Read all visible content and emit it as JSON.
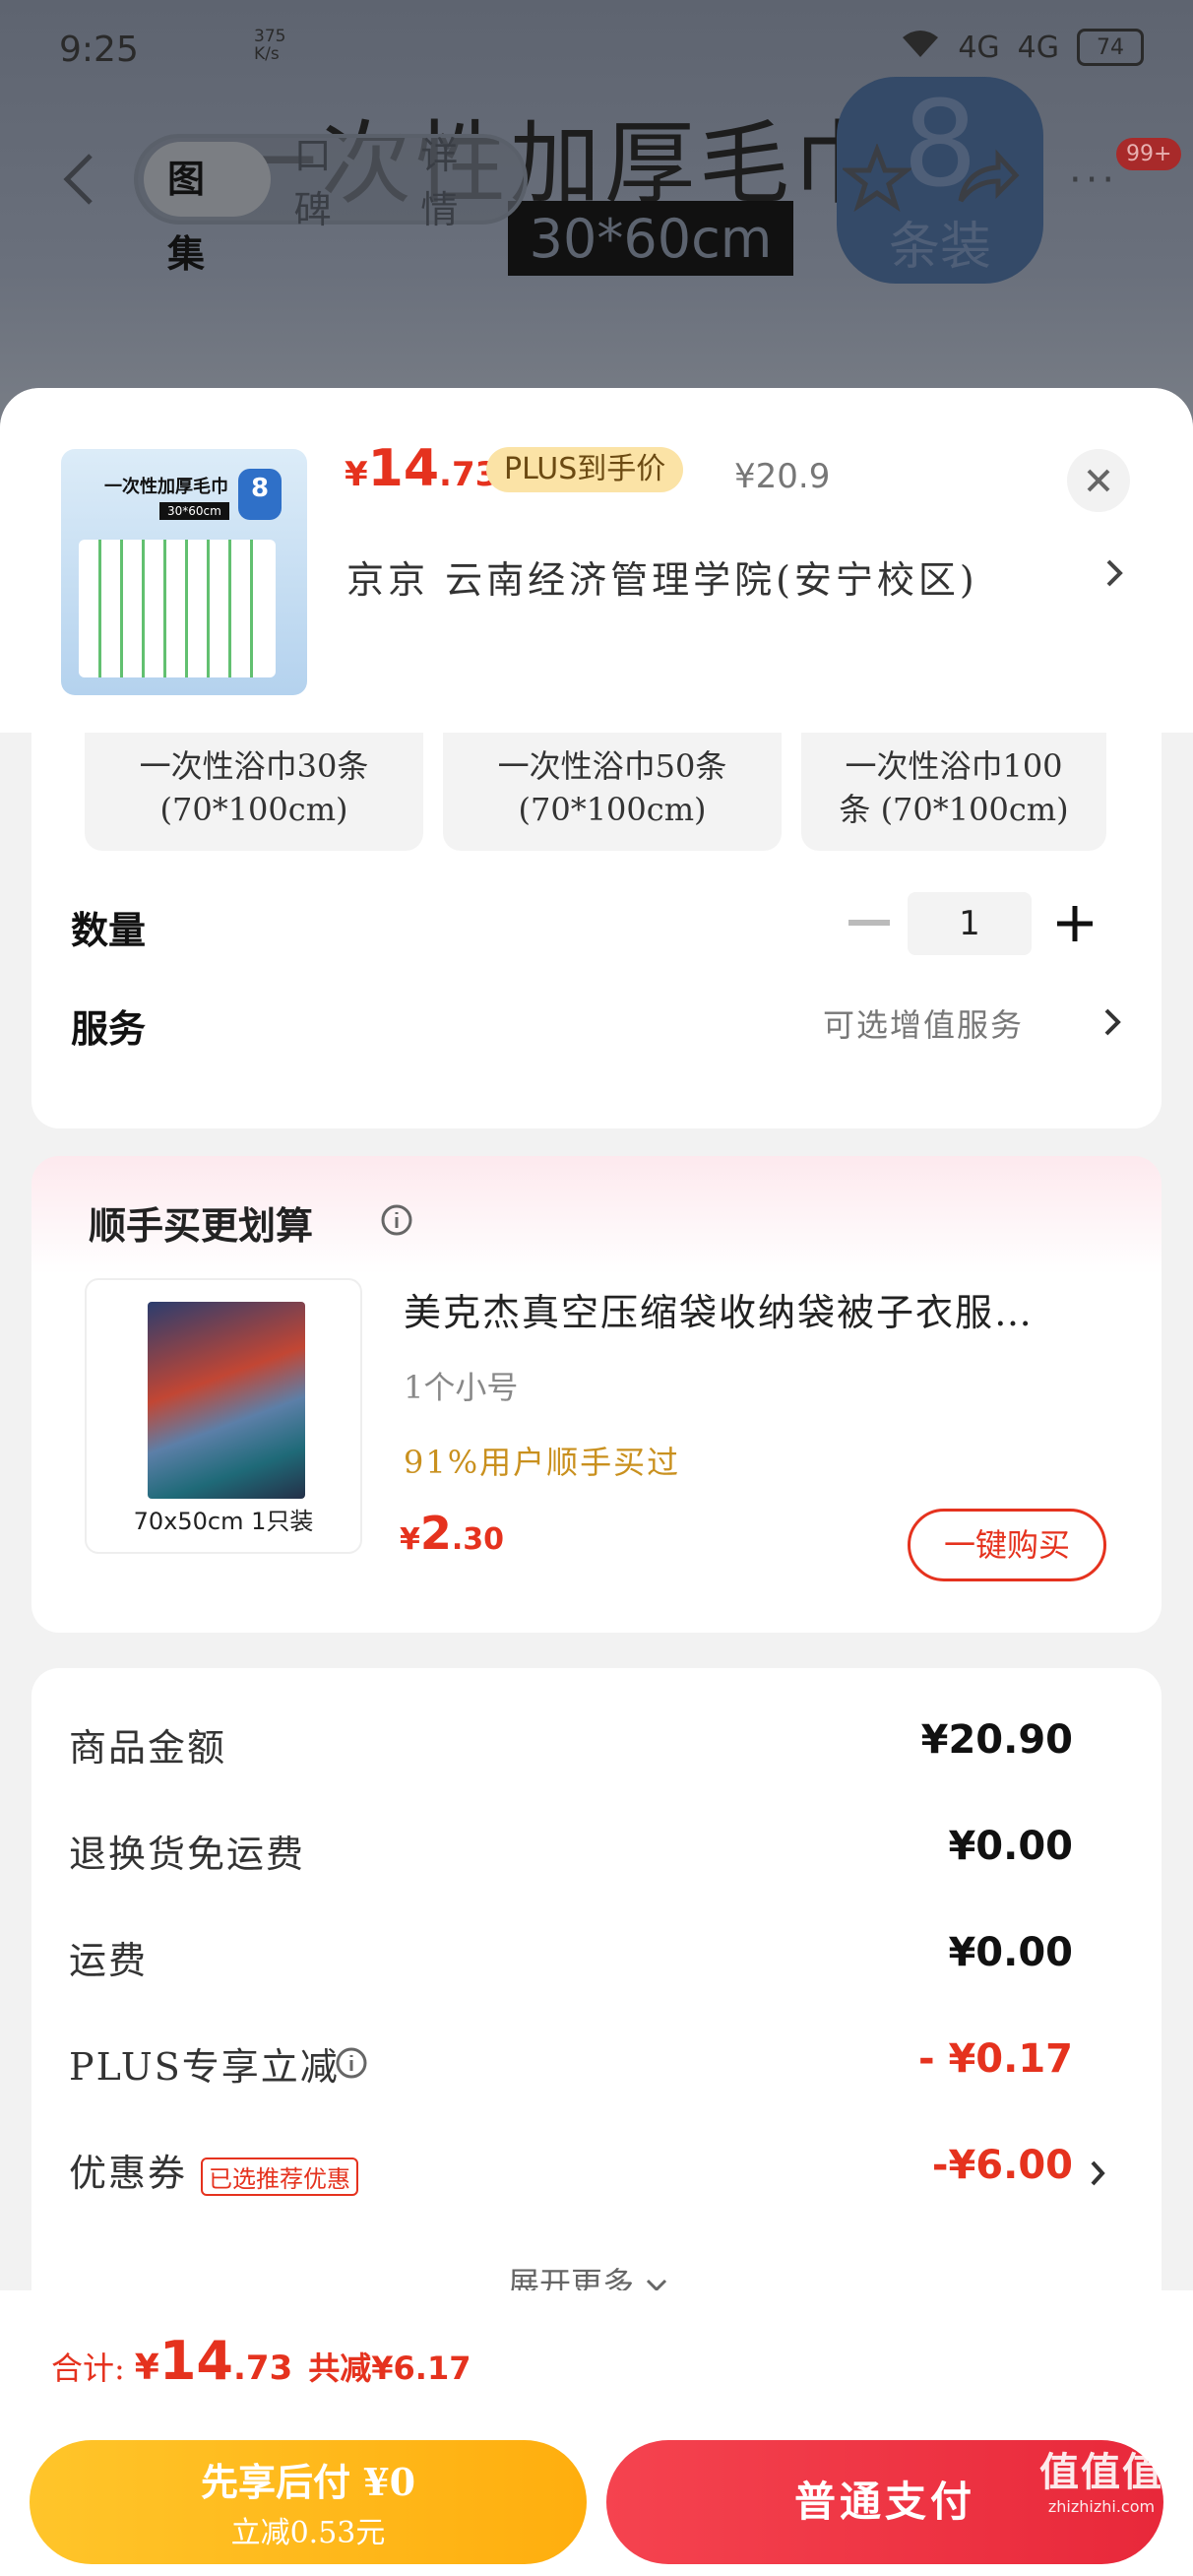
{
  "status_bar": {
    "time": "9:25",
    "net_speed_value": "375",
    "net_speed_unit": "K/s",
    "signal_1": "4G",
    "signal_2": "4G",
    "battery": "74"
  },
  "background": {
    "banner_title": "一次性加厚毛巾",
    "banner_size": "30*60cm",
    "badge_number": "8",
    "badge_text": "条装",
    "tabs": [
      "图集",
      "口碑",
      "详情"
    ],
    "notification_count": "99+",
    "more": "···"
  },
  "product": {
    "thumb_title": "一次性加厚毛巾",
    "thumb_size": "30*60cm",
    "thumb_badge": "8",
    "price_symbol": "¥",
    "price_int": "14",
    "price_dec": ".73",
    "plus_tag": "PLUS到手价",
    "original_price": "¥20.9",
    "address": "京京   云南经济管理学院(安宁校区)"
  },
  "specs": [
    {
      "line1": "一次性浴巾30条",
      "line2": "(70*100cm)"
    },
    {
      "line1": "一次性浴巾50条",
      "line2": "(70*100cm)"
    },
    {
      "line1": "一次性浴巾100",
      "line2": "条   (70*100cm)"
    }
  ],
  "quantity": {
    "label": "数量",
    "value": "1"
  },
  "service": {
    "label": "服务",
    "value": "可选增值服务"
  },
  "combo": {
    "title": "顺手买更划算",
    "img_caption": "70x50cm 1只装",
    "name": "美克杰真空压缩袋收纳袋被子衣服…",
    "spec": "1个小号",
    "buyers": "91%用户顺手买过",
    "price_symbol": "¥",
    "price_int": "2",
    "price_dec": ".30",
    "buy_button": "一键购买"
  },
  "summary": {
    "rows": [
      {
        "label": "商品金额",
        "value": "¥20.90"
      },
      {
        "label": "退换货免运费",
        "value": "¥0.00"
      },
      {
        "label": "运费",
        "value": "¥0.00"
      },
      {
        "label": "PLUS专享立减",
        "value": "- ¥0.17"
      },
      {
        "label": "优惠券",
        "value": "-¥6.00",
        "tag": "已选推荐优惠"
      }
    ],
    "expand": "展开更多"
  },
  "bottom": {
    "total_label": "合计:",
    "total_symbol": "¥",
    "total_int": "14",
    "total_dec": ".73",
    "total_saved": "共减¥6.17",
    "later_title": "先享后付 ¥0",
    "later_sub": "立减0.53元",
    "pay_button": "普通支付"
  },
  "watermark": {
    "line1": "值值值",
    "line2": "zhizhizhi.com"
  },
  "colors": {
    "accent_red": "#e5321e",
    "plus_gold": "#fbe3a6",
    "later_yellow": "#ffb514",
    "pay_red": "#ee3242"
  }
}
